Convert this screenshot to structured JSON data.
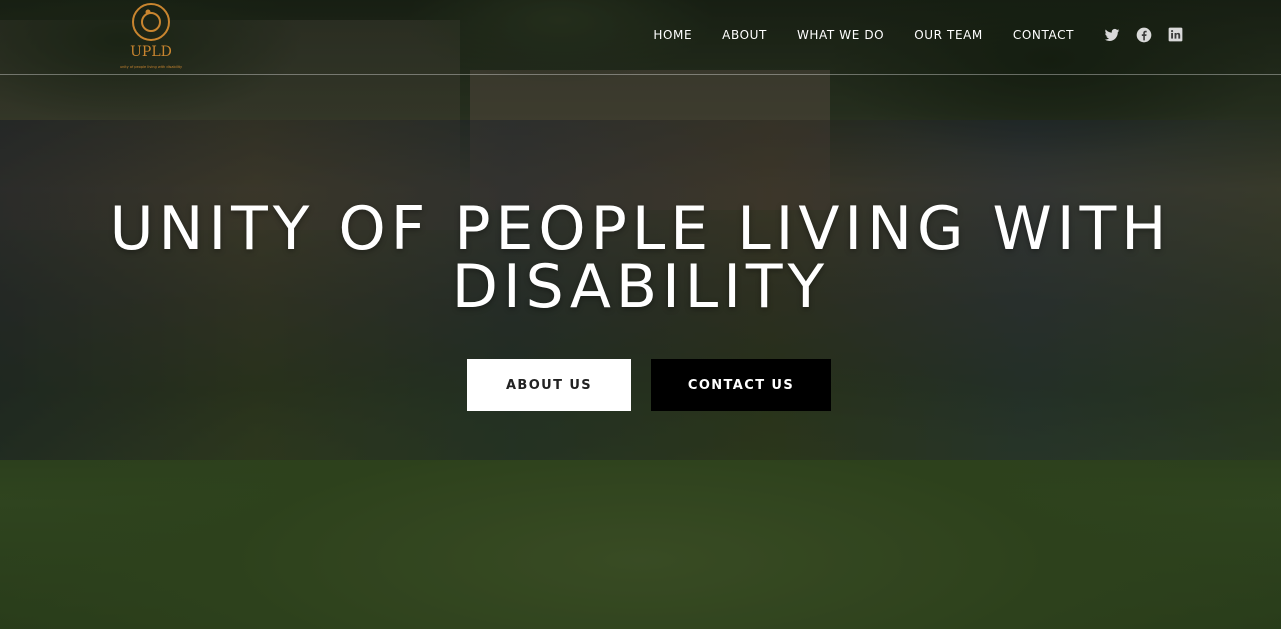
{
  "site": {
    "logo_text": "UPLD",
    "logo_subtext": "unity of people living with disability",
    "logo_color": "#c9852f"
  },
  "nav": {
    "items": [
      {
        "label": "HOME"
      },
      {
        "label": "ABOUT"
      },
      {
        "label": "WHAT WE DO"
      },
      {
        "label": "OUR TEAM"
      },
      {
        "label": "CONTACT"
      }
    ]
  },
  "social": {
    "icons": [
      "twitter-icon",
      "facebook-icon",
      "linkedin-icon"
    ],
    "icon_color": "#d9d9d9"
  },
  "hero": {
    "title_line1": "UNITY OF PEOPLE LIVING WITH",
    "title_line2": "DISABILITY",
    "about_button": "ABOUT US",
    "contact_button": "CONTACT US"
  }
}
